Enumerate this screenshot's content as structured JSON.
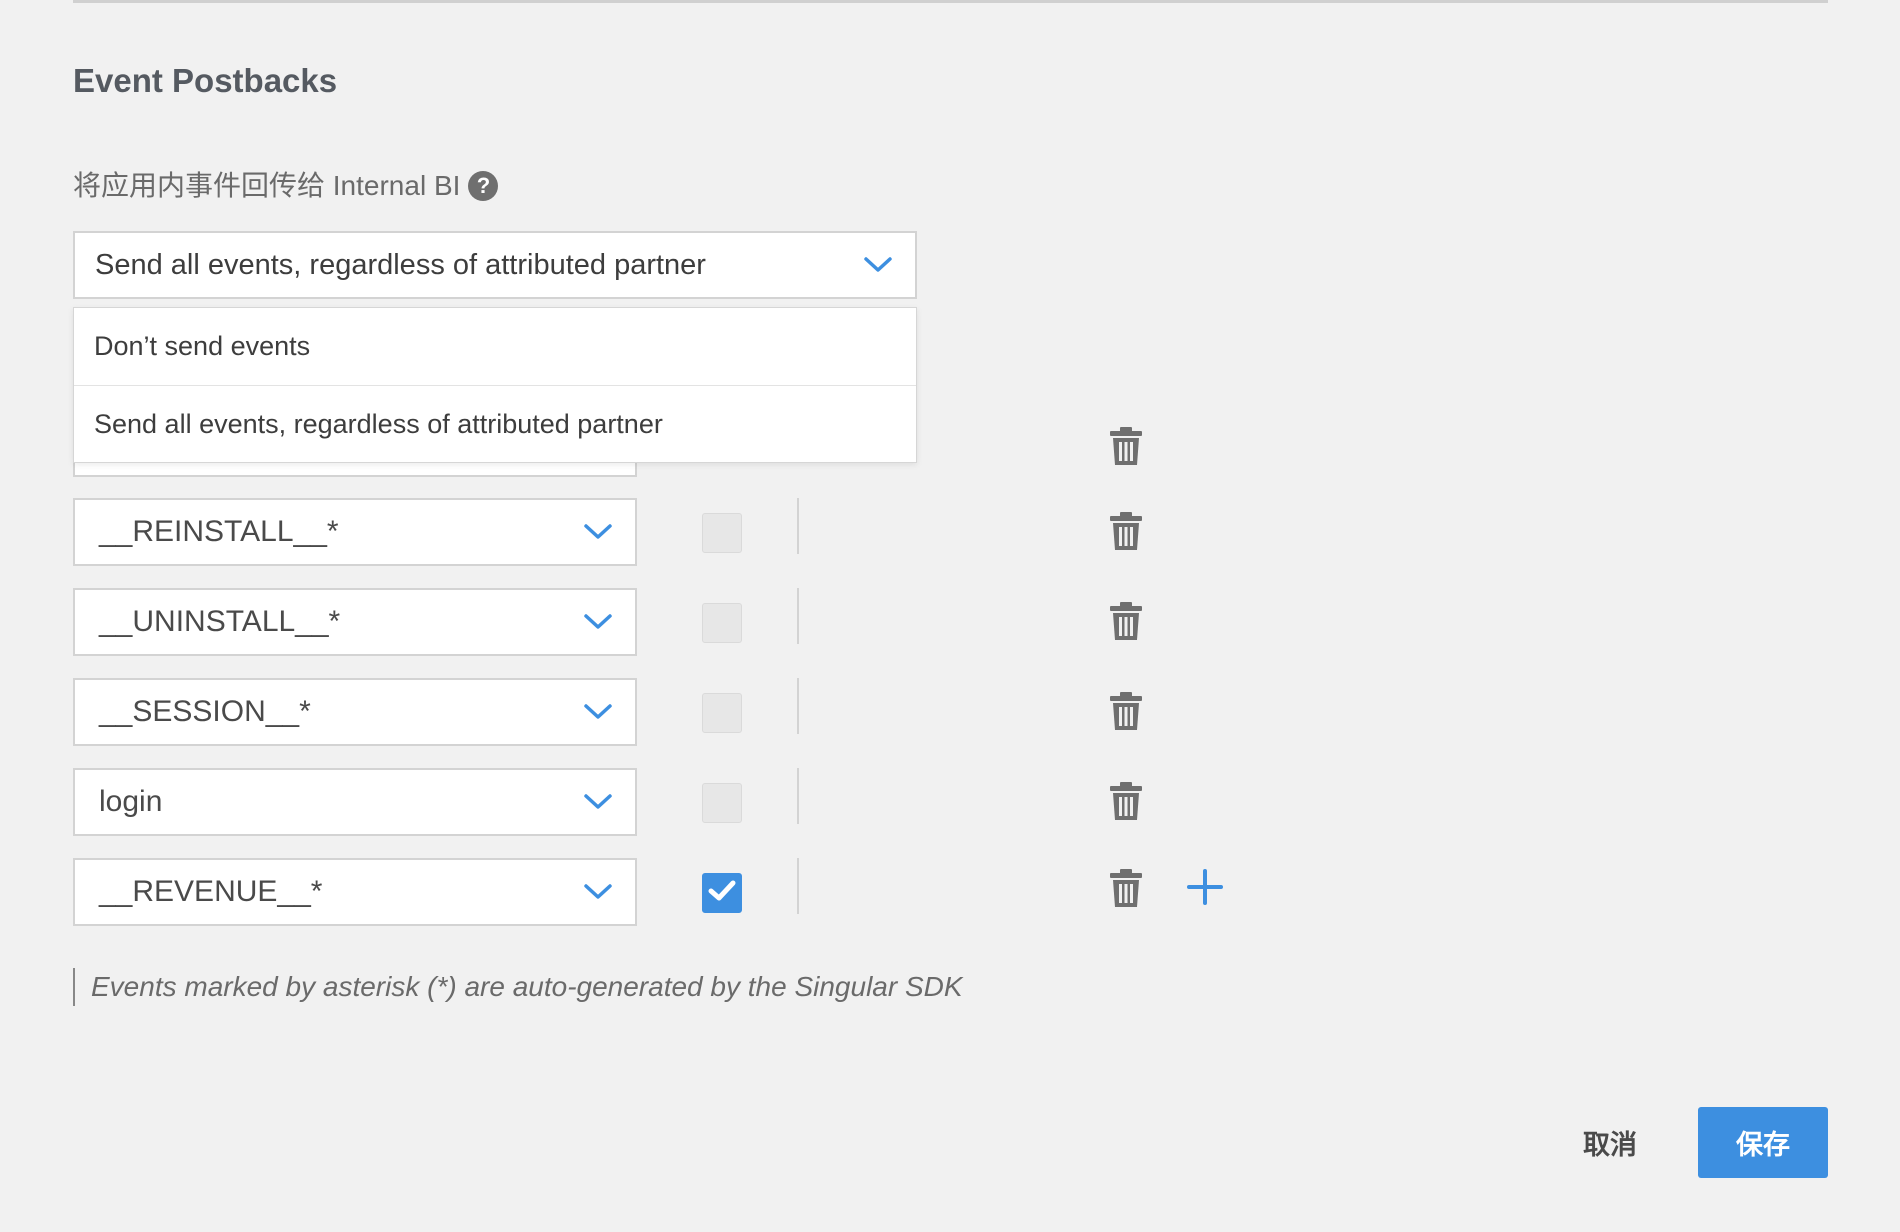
{
  "section": {
    "title": "Event Postbacks",
    "send_label": "将应用内事件回传给 Internal BI",
    "help_icon_glyph": "?"
  },
  "postback_select": {
    "value": "Send all events, regardless of attributed partner",
    "options": [
      "Don’t send events",
      "Send all events, regardless of attributed partner"
    ]
  },
  "events": [
    {
      "name": "__REINSTALL__*",
      "checked": false
    },
    {
      "name": "__UNINSTALL__*",
      "checked": false
    },
    {
      "name": "__SESSION__*",
      "checked": false
    },
    {
      "name": "login",
      "checked": false
    },
    {
      "name": "__REVENUE__*",
      "checked": true
    }
  ],
  "note": "Events marked by asterisk (*) are auto-generated by the Singular SDK",
  "buttons": {
    "cancel": "取消",
    "save": "保存"
  },
  "icons": {
    "chevron": "chevron-down-icon",
    "trash": "trash-icon",
    "plus": "plus-icon",
    "check": "checkmark-icon",
    "help": "question-icon"
  },
  "colors": {
    "accent": "#3d8fe0",
    "background": "#f1f1f1",
    "icon_gray": "#6f6f6f"
  }
}
